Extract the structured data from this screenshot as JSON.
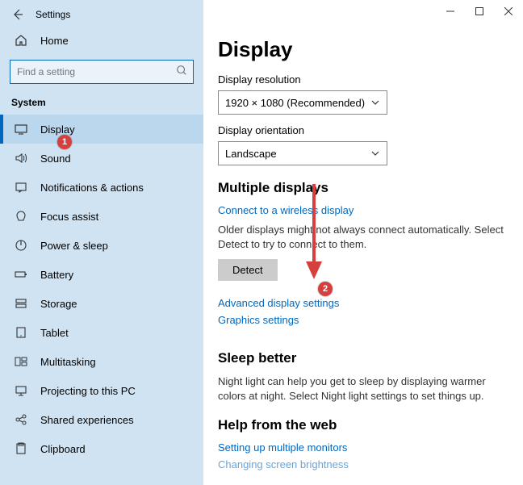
{
  "window": {
    "title": "Settings",
    "search_placeholder": "Find a setting",
    "home_label": "Home",
    "section_label": "System",
    "nav": [
      {
        "label": "Display"
      },
      {
        "label": "Sound"
      },
      {
        "label": "Notifications & actions"
      },
      {
        "label": "Focus assist"
      },
      {
        "label": "Power & sleep"
      },
      {
        "label": "Battery"
      },
      {
        "label": "Storage"
      },
      {
        "label": "Tablet"
      },
      {
        "label": "Multitasking"
      },
      {
        "label": "Projecting to this PC"
      },
      {
        "label": "Shared experiences"
      },
      {
        "label": "Clipboard"
      }
    ]
  },
  "main": {
    "heading": "Display",
    "resolution_label": "Display resolution",
    "resolution_value": "1920 × 1080 (Recommended)",
    "orientation_label": "Display orientation",
    "orientation_value": "Landscape",
    "multi_heading": "Multiple displays",
    "connect_link": "Connect to a wireless display",
    "detect_para": "Older displays might not always connect automatically. Select Detect to try to connect to them.",
    "detect_button": "Detect",
    "adv_link": "Advanced display settings",
    "graphics_link": "Graphics settings",
    "sleep_heading": "Sleep better",
    "sleep_para": "Night light can help you get to sleep by displaying warmer colors at night. Select Night light settings to set things up.",
    "help_heading": "Help from the web",
    "help_link1": "Setting up multiple monitors",
    "help_link2": "Changing screen brightness"
  },
  "callouts": {
    "one": "1",
    "two": "2"
  }
}
